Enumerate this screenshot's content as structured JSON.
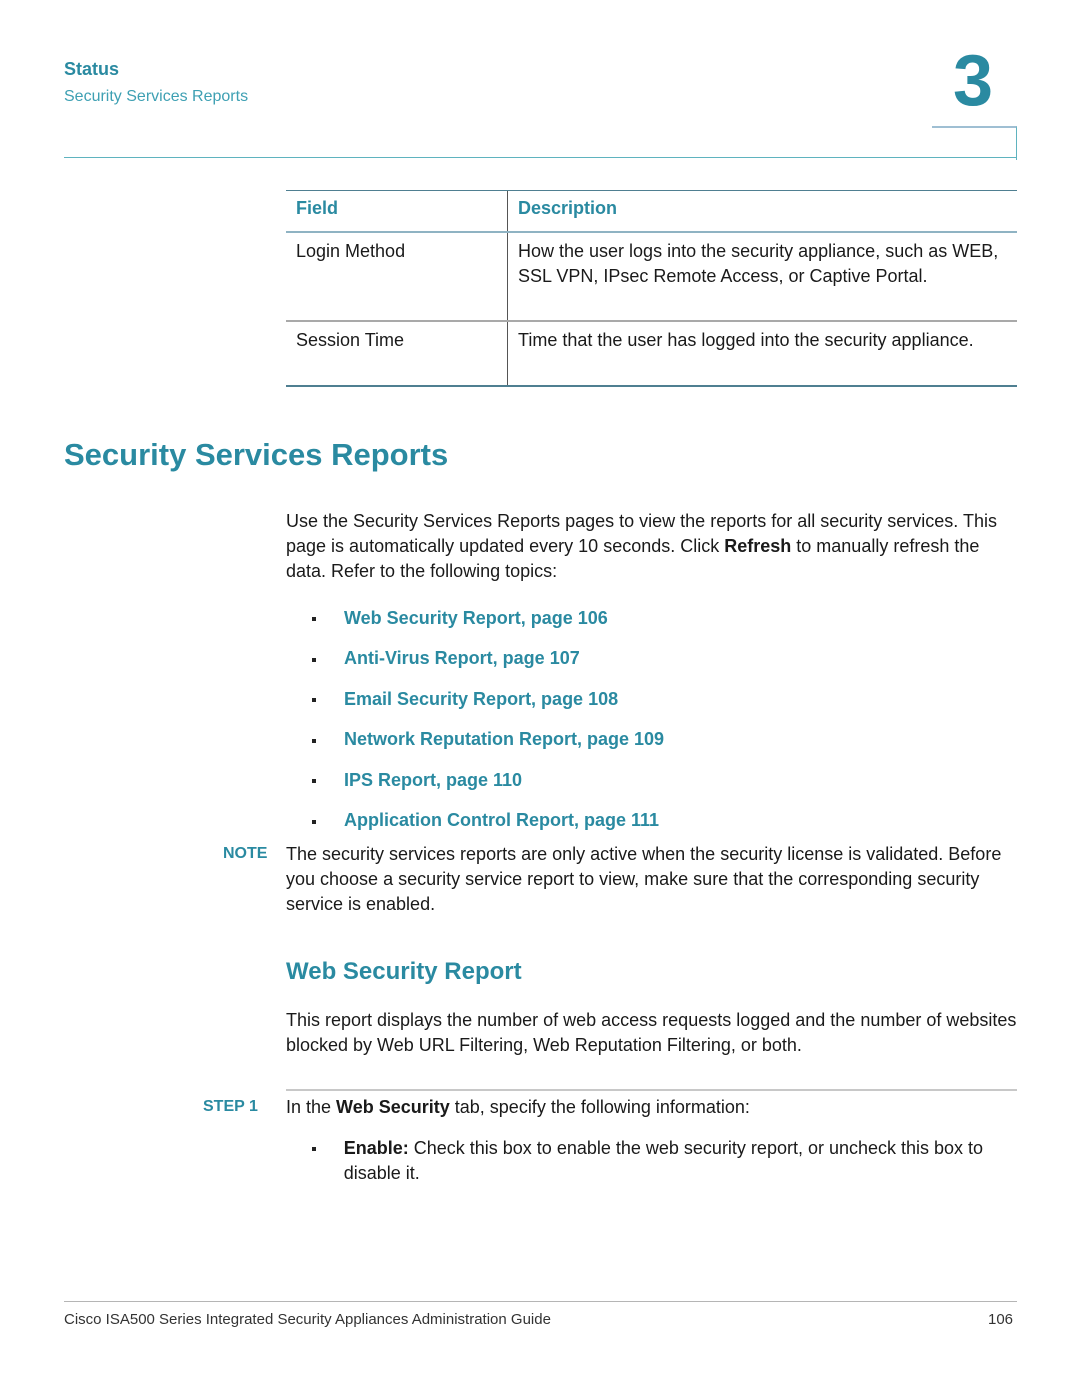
{
  "header": {
    "section": "Status",
    "subsection": "Security Services Reports",
    "chapter_number": "3"
  },
  "table": {
    "columns": [
      "Field",
      "Description"
    ],
    "rows": [
      {
        "field": "Login Method",
        "description": "How the user logs into the security appliance, such as WEB, SSL VPN, IPsec Remote Access, or Captive Portal."
      },
      {
        "field": "Session Time",
        "description": "Time that the user has logged into the security appliance."
      }
    ]
  },
  "main": {
    "heading": "Security Services Reports",
    "intro": {
      "part1": "Use the Security Services Reports pages to view the reports for all security services. This page is automatically updated every 10 seconds. Click ",
      "bold": "Refresh",
      "part2": " to manually refresh the data. Refer to the following topics:"
    },
    "links": [
      "Web Security Report, page 106",
      "Anti-Virus Report, page 107",
      "Email Security Report, page 108",
      "Network Reputation Report, page 109",
      "IPS Report, page 110",
      "Application Control Report, page 111"
    ],
    "note": {
      "label": "NOTE",
      "text": "The security services reports are only active when the security license is validated. Before you choose a security service report to view, make sure that the corresponding security service is enabled."
    }
  },
  "web_security": {
    "heading": "Web Security Report",
    "description": "This report displays the number of web access requests logged and the number of websites blocked by Web URL Filtering, Web Reputation Filtering, or both.",
    "step": {
      "label": "STEP 1",
      "prefix": "In the ",
      "bold": "Web Security",
      "suffix": " tab, specify the following information:"
    },
    "bullet": {
      "bold": "Enable:",
      "text": " Check this box to enable the web security report, or uncheck this box to disable it."
    }
  },
  "footer": {
    "title": "Cisco ISA500 Series Integrated Security Appliances Administration Guide",
    "page": "106"
  }
}
